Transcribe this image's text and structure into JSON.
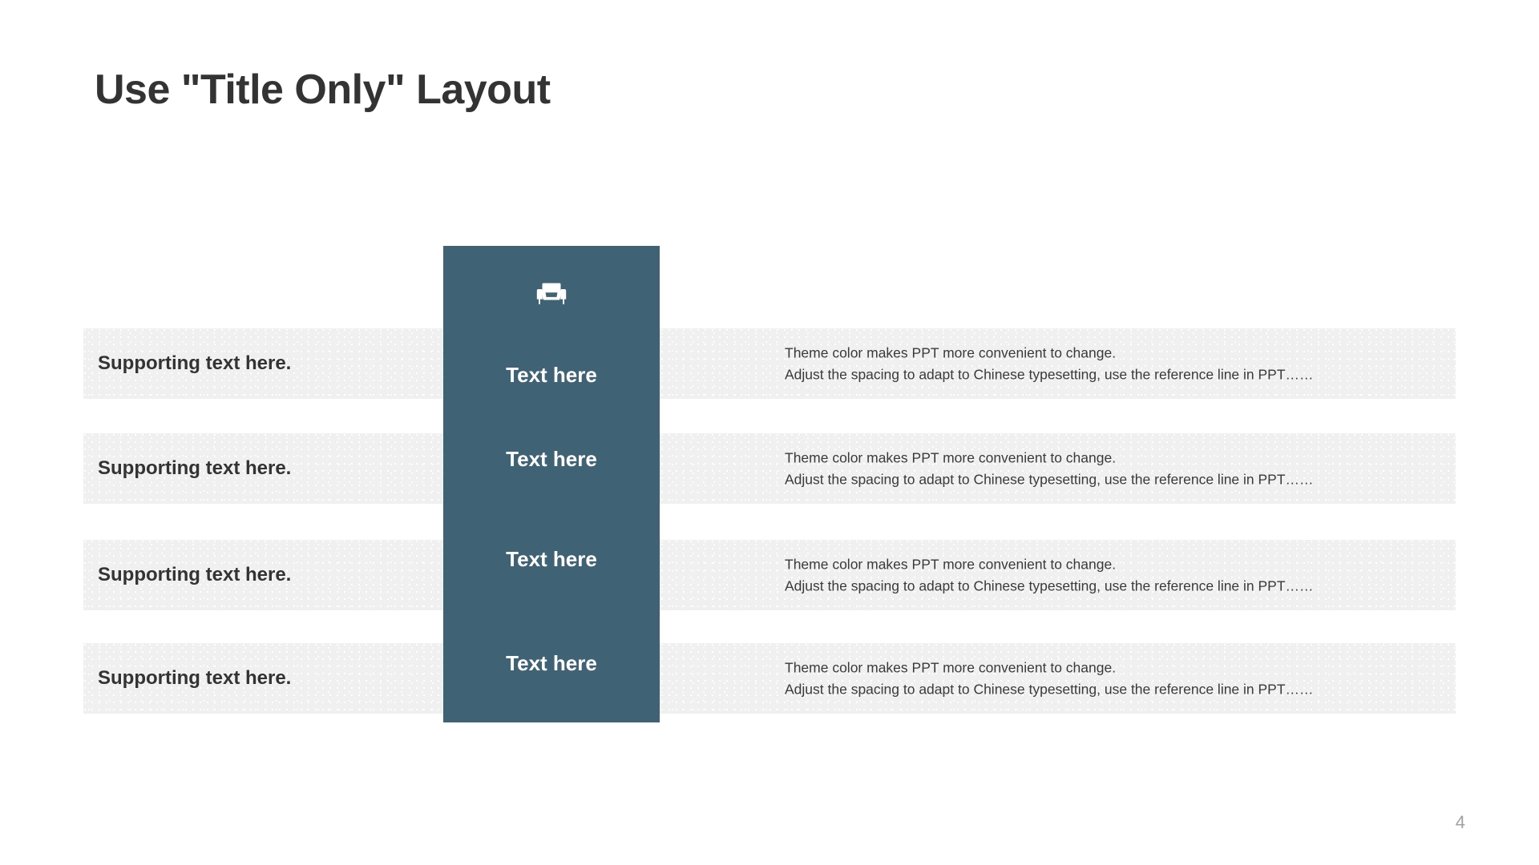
{
  "slide": {
    "title": "Use \"Title Only\" Layout",
    "page_number": "4",
    "theme": {
      "accent_color": "#3f6274",
      "band_color": "#f0f0f0",
      "title_color": "#333333",
      "page_number_color": "#a0a0a0"
    }
  },
  "center_column": {
    "icon": "armchair-icon",
    "labels": [
      {
        "text": "Text here"
      },
      {
        "text": "Text here"
      },
      {
        "text": "Text here"
      },
      {
        "text": "Text here"
      }
    ]
  },
  "rows": [
    {
      "label": "Supporting text here.",
      "desc_line_1": "Theme color makes PPT more convenient to change.",
      "desc_line_2": "Adjust the spacing to adapt to Chinese typesetting, use the reference line in PPT……"
    },
    {
      "label": "Supporting text here.",
      "desc_line_1": "Theme color makes PPT more convenient to change.",
      "desc_line_2": "Adjust the spacing to adapt to Chinese typesetting, use the reference line in PPT……"
    },
    {
      "label": "Supporting text here.",
      "desc_line_1": "Theme color makes PPT more convenient to change.",
      "desc_line_2": "Adjust the spacing to adapt to Chinese typesetting, use the reference line in PPT……"
    },
    {
      "label": "Supporting text here.",
      "desc_line_1": "Theme color makes PPT more convenient to change.",
      "desc_line_2": "Adjust the spacing to adapt to Chinese typesetting, use the reference line in PPT……"
    }
  ]
}
